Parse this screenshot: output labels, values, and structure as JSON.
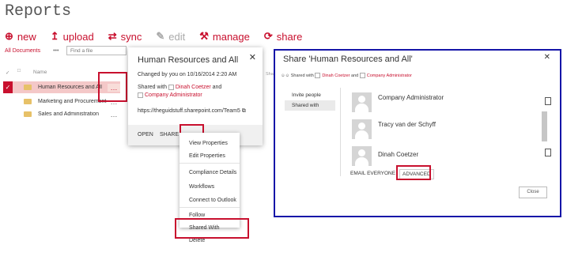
{
  "page_title": "Reports",
  "toolbar": {
    "new": "new",
    "upload": "upload",
    "sync": "sync",
    "edit": "edit",
    "manage": "manage",
    "share": "share"
  },
  "views": {
    "all_documents": "All Documents",
    "more": "•••",
    "find_placeholder": "Find a file"
  },
  "list": {
    "col_name": "Name",
    "rows": [
      {
        "name": "Human Resources and All"
      },
      {
        "name": "Marketing and Procurement"
      },
      {
        "name": "Sales and Administration"
      }
    ]
  },
  "callout": {
    "title": "Human Resources and All",
    "changed": "Changed by you on 10/16/2014 2:20 AM",
    "shared_with_prefix": "Shared with",
    "shared_user1": "Dinah Coetzer",
    "and": "and",
    "shared_user2": "Company Administrator",
    "link": "https://theguidstuff.sharepoint.com/Team5",
    "open": "OPEN",
    "share": "SHARE",
    "more": "•••",
    "side_label": "Share"
  },
  "menu": {
    "items": [
      "View Properties",
      "Edit Properties",
      "Compliance Details",
      "Workflows",
      "Connect to Outlook",
      "Follow",
      "Shared With",
      "Delete"
    ]
  },
  "share_dialog": {
    "title": "Share 'Human Resources and All'",
    "shared_with_prefix": "Shared with",
    "user1": "Dinah Coetzer",
    "and": "and",
    "user2": "Company Administrator",
    "tabs": [
      "Invite people",
      "Shared with"
    ],
    "people": [
      "Company Administrator",
      "Tracy van der Schyff",
      "Dinah Coetzer"
    ],
    "email_everyone": "EMAIL EVERYONE",
    "advanced": "ADVANCED",
    "close": "Close"
  },
  "colors": {
    "accent": "#c8102e",
    "dialog_border": "#1515a8"
  }
}
